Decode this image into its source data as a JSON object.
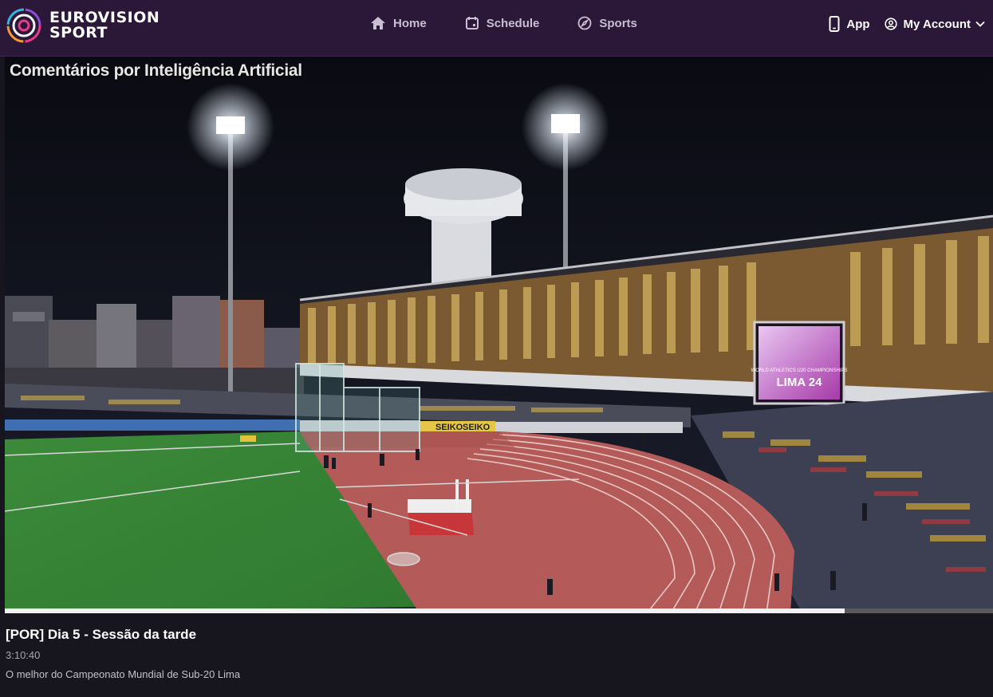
{
  "header": {
    "brand_line1": "EUROVISION",
    "brand_line2": "SPORT",
    "nav": [
      {
        "label": "Home",
        "icon": "home-icon"
      },
      {
        "label": "Schedule",
        "icon": "calendar-icon"
      },
      {
        "label": "Sports",
        "icon": "compass-icon"
      }
    ],
    "app_label": "App",
    "account_label": "My Account"
  },
  "player": {
    "overlay_caption": "Comentários por Inteligência Artificial",
    "scoreboard_text": [
      "WORLD ATHLETICS U20 CHAMPIONSHIPS",
      "LIMA 24"
    ],
    "ad_boards": [
      "SEIKO",
      "SEIKO"
    ],
    "progress_fraction": 0.85
  },
  "video": {
    "title": "[POR] Dia 5 - Sessão da tarde",
    "duration": "3:10:40",
    "description": "O melhor do Campeonato Mundial de Sub-20 Lima"
  },
  "colors": {
    "header_bg": "#2b1737",
    "page_bg": "#17151d",
    "track": "#b45a58",
    "grass": "#3f8f3c"
  }
}
